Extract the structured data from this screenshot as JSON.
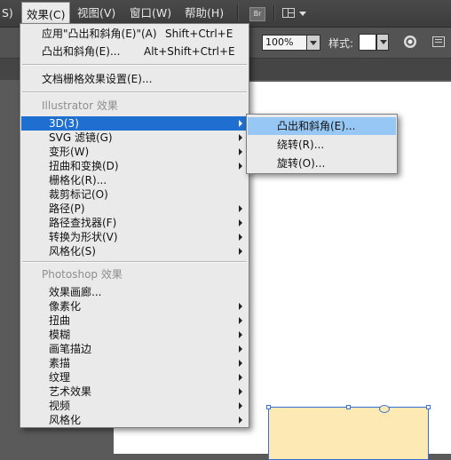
{
  "menubar": {
    "items": [
      {
        "label": "S)"
      },
      {
        "label": "效果(C)"
      },
      {
        "label": "视图(V)"
      },
      {
        "label": "窗口(W)"
      },
      {
        "label": "帮助(H)"
      }
    ],
    "bridge_label": "Br"
  },
  "controlbar": {
    "zoom_value": "100%",
    "style_label": "样式:"
  },
  "effect_menu": {
    "apply_last": {
      "label": "应用\"凸出和斜角(E)\"(A)",
      "shortcut": "Shift+Ctrl+E"
    },
    "last_effect": {
      "label": "凸出和斜角(E)...",
      "shortcut": "Alt+Shift+Ctrl+E"
    },
    "raster_settings": {
      "label": "文档栅格效果设置(E)..."
    },
    "illustrator_section": "Illustrator 效果",
    "illustrator_items": [
      {
        "label": "3D(3)",
        "submenu": true
      },
      {
        "label": "SVG 滤镜(G)",
        "submenu": true
      },
      {
        "label": "变形(W)",
        "submenu": true
      },
      {
        "label": "扭曲和变换(D)",
        "submenu": true
      },
      {
        "label": "栅格化(R)...",
        "submenu": false
      },
      {
        "label": "裁剪标记(O)",
        "submenu": false
      },
      {
        "label": "路径(P)",
        "submenu": true
      },
      {
        "label": "路径查找器(F)",
        "submenu": true
      },
      {
        "label": "转换为形状(V)",
        "submenu": true
      },
      {
        "label": "风格化(S)",
        "submenu": true
      }
    ],
    "photoshop_section": "Photoshop 效果",
    "photoshop_items": [
      {
        "label": "效果画廊...",
        "submenu": false
      },
      {
        "label": "像素化",
        "submenu": true
      },
      {
        "label": "扭曲",
        "submenu": true
      },
      {
        "label": "模糊",
        "submenu": true
      },
      {
        "label": "画笔描边",
        "submenu": true
      },
      {
        "label": "素描",
        "submenu": true
      },
      {
        "label": "纹理",
        "submenu": true
      },
      {
        "label": "艺术效果",
        "submenu": true
      },
      {
        "label": "视频",
        "submenu": true
      },
      {
        "label": "风格化",
        "submenu": true
      }
    ]
  },
  "submenu_3d": {
    "items": [
      {
        "label": "凸出和斜角(E)..."
      },
      {
        "label": "绕转(R)..."
      },
      {
        "label": "旋转(O)..."
      }
    ]
  },
  "colors": {
    "highlight": "#1f6fd0",
    "submenu_highlight": "#97c7f4",
    "shape_fill": "#fde9b4",
    "selection": "#3b6fd6"
  }
}
